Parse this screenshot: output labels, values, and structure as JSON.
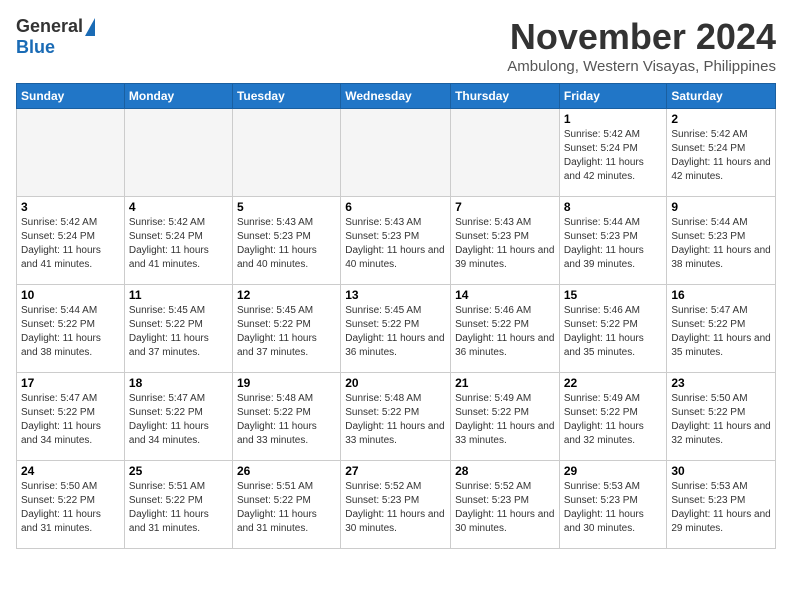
{
  "header": {
    "logo_general": "General",
    "logo_blue": "Blue",
    "month_title": "November 2024",
    "subtitle": "Ambulong, Western Visayas, Philippines"
  },
  "weekdays": [
    "Sunday",
    "Monday",
    "Tuesday",
    "Wednesday",
    "Thursday",
    "Friday",
    "Saturday"
  ],
  "weeks": [
    [
      {
        "day": "",
        "empty": true
      },
      {
        "day": "",
        "empty": true
      },
      {
        "day": "",
        "empty": true
      },
      {
        "day": "",
        "empty": true
      },
      {
        "day": "",
        "empty": true
      },
      {
        "day": "1",
        "sunrise": "5:42 AM",
        "sunset": "5:24 PM",
        "daylight": "11 hours and 42 minutes."
      },
      {
        "day": "2",
        "sunrise": "5:42 AM",
        "sunset": "5:24 PM",
        "daylight": "11 hours and 42 minutes."
      }
    ],
    [
      {
        "day": "3",
        "sunrise": "5:42 AM",
        "sunset": "5:24 PM",
        "daylight": "11 hours and 41 minutes."
      },
      {
        "day": "4",
        "sunrise": "5:42 AM",
        "sunset": "5:24 PM",
        "daylight": "11 hours and 41 minutes."
      },
      {
        "day": "5",
        "sunrise": "5:43 AM",
        "sunset": "5:23 PM",
        "daylight": "11 hours and 40 minutes."
      },
      {
        "day": "6",
        "sunrise": "5:43 AM",
        "sunset": "5:23 PM",
        "daylight": "11 hours and 40 minutes."
      },
      {
        "day": "7",
        "sunrise": "5:43 AM",
        "sunset": "5:23 PM",
        "daylight": "11 hours and 39 minutes."
      },
      {
        "day": "8",
        "sunrise": "5:44 AM",
        "sunset": "5:23 PM",
        "daylight": "11 hours and 39 minutes."
      },
      {
        "day": "9",
        "sunrise": "5:44 AM",
        "sunset": "5:23 PM",
        "daylight": "11 hours and 38 minutes."
      }
    ],
    [
      {
        "day": "10",
        "sunrise": "5:44 AM",
        "sunset": "5:22 PM",
        "daylight": "11 hours and 38 minutes."
      },
      {
        "day": "11",
        "sunrise": "5:45 AM",
        "sunset": "5:22 PM",
        "daylight": "11 hours and 37 minutes."
      },
      {
        "day": "12",
        "sunrise": "5:45 AM",
        "sunset": "5:22 PM",
        "daylight": "11 hours and 37 minutes."
      },
      {
        "day": "13",
        "sunrise": "5:45 AM",
        "sunset": "5:22 PM",
        "daylight": "11 hours and 36 minutes."
      },
      {
        "day": "14",
        "sunrise": "5:46 AM",
        "sunset": "5:22 PM",
        "daylight": "11 hours and 36 minutes."
      },
      {
        "day": "15",
        "sunrise": "5:46 AM",
        "sunset": "5:22 PM",
        "daylight": "11 hours and 35 minutes."
      },
      {
        "day": "16",
        "sunrise": "5:47 AM",
        "sunset": "5:22 PM",
        "daylight": "11 hours and 35 minutes."
      }
    ],
    [
      {
        "day": "17",
        "sunrise": "5:47 AM",
        "sunset": "5:22 PM",
        "daylight": "11 hours and 34 minutes."
      },
      {
        "day": "18",
        "sunrise": "5:47 AM",
        "sunset": "5:22 PM",
        "daylight": "11 hours and 34 minutes."
      },
      {
        "day": "19",
        "sunrise": "5:48 AM",
        "sunset": "5:22 PM",
        "daylight": "11 hours and 33 minutes."
      },
      {
        "day": "20",
        "sunrise": "5:48 AM",
        "sunset": "5:22 PM",
        "daylight": "11 hours and 33 minutes."
      },
      {
        "day": "21",
        "sunrise": "5:49 AM",
        "sunset": "5:22 PM",
        "daylight": "11 hours and 33 minutes."
      },
      {
        "day": "22",
        "sunrise": "5:49 AM",
        "sunset": "5:22 PM",
        "daylight": "11 hours and 32 minutes."
      },
      {
        "day": "23",
        "sunrise": "5:50 AM",
        "sunset": "5:22 PM",
        "daylight": "11 hours and 32 minutes."
      }
    ],
    [
      {
        "day": "24",
        "sunrise": "5:50 AM",
        "sunset": "5:22 PM",
        "daylight": "11 hours and 31 minutes."
      },
      {
        "day": "25",
        "sunrise": "5:51 AM",
        "sunset": "5:22 PM",
        "daylight": "11 hours and 31 minutes."
      },
      {
        "day": "26",
        "sunrise": "5:51 AM",
        "sunset": "5:22 PM",
        "daylight": "11 hours and 31 minutes."
      },
      {
        "day": "27",
        "sunrise": "5:52 AM",
        "sunset": "5:23 PM",
        "daylight": "11 hours and 30 minutes."
      },
      {
        "day": "28",
        "sunrise": "5:52 AM",
        "sunset": "5:23 PM",
        "daylight": "11 hours and 30 minutes."
      },
      {
        "day": "29",
        "sunrise": "5:53 AM",
        "sunset": "5:23 PM",
        "daylight": "11 hours and 30 minutes."
      },
      {
        "day": "30",
        "sunrise": "5:53 AM",
        "sunset": "5:23 PM",
        "daylight": "11 hours and 29 minutes."
      }
    ]
  ]
}
